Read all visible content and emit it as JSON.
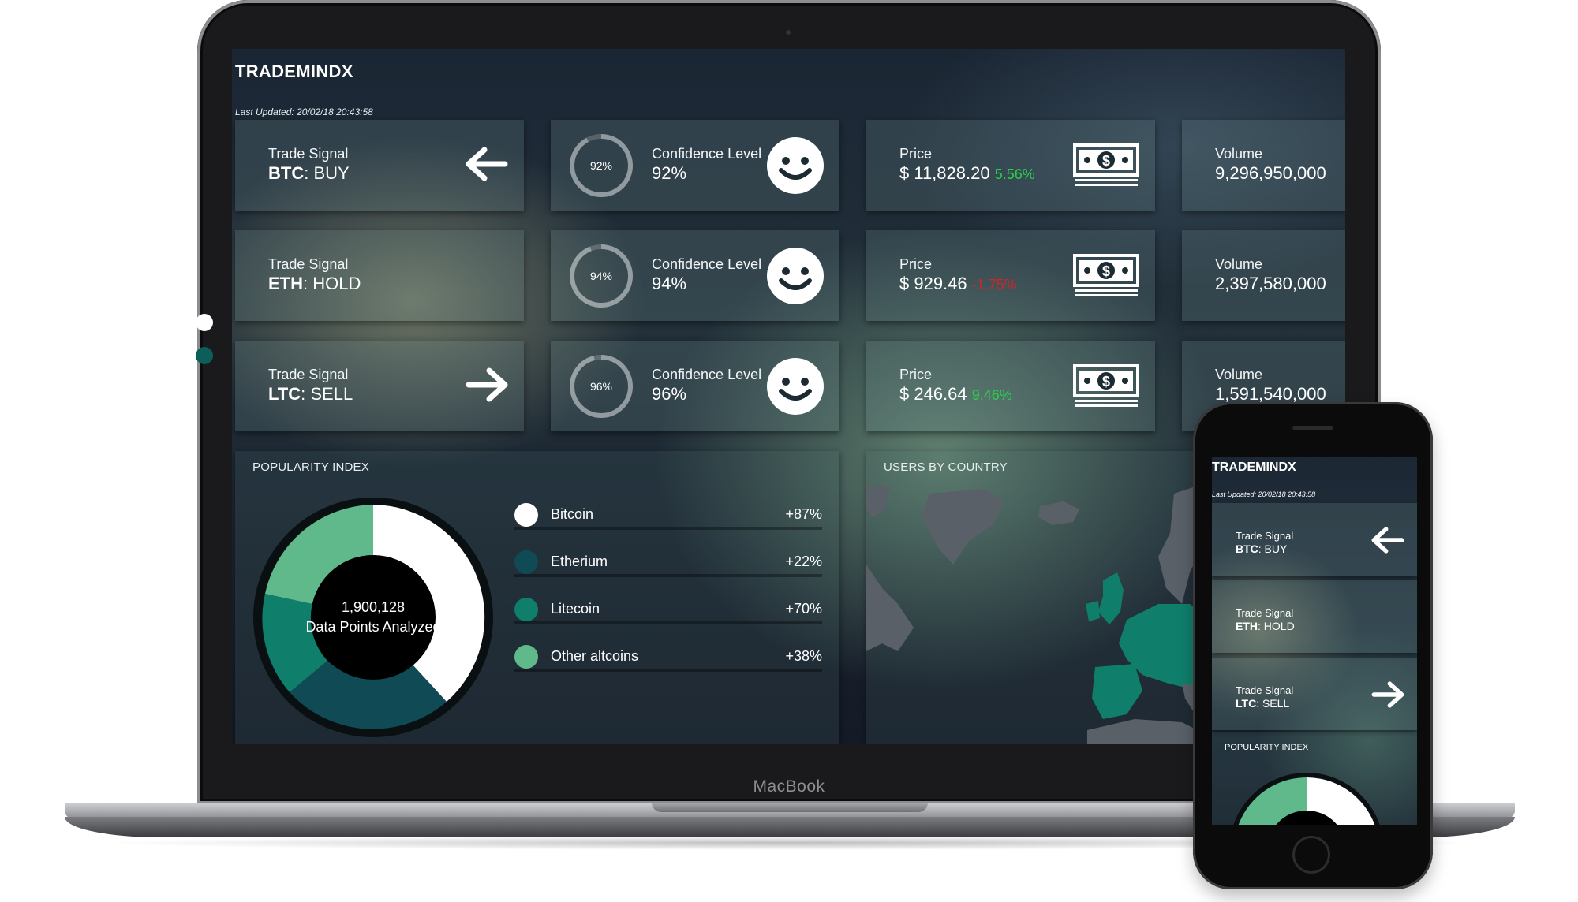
{
  "device": {
    "laptop_label": "MacBook"
  },
  "app": {
    "brand": "TRADEMINDX",
    "last_updated": "Last Updated: 20/02/18 20:43:58"
  },
  "signals": [
    {
      "label": "Trade Signal",
      "coin": "BTC",
      "action": ": BUY",
      "direction": "left"
    },
    {
      "label": "Trade Signal",
      "coin": "ETH",
      "action": ": HOLD",
      "direction": "none"
    },
    {
      "label": "Trade Signal",
      "coin": "LTC",
      "action": ": SELL",
      "direction": "right"
    }
  ],
  "confidence": [
    {
      "ring": "92%",
      "label": "Confidence Level",
      "value": "92%",
      "level": 0.92,
      "icon": "smiley-icon"
    },
    {
      "ring": "94%",
      "label": "Confidence Level",
      "value": "94%",
      "level": 0.94,
      "icon": "smiley-icon"
    },
    {
      "ring": "96%",
      "label": "Confidence Level",
      "value": "96%",
      "level": 0.96,
      "icon": "smiley-icon"
    }
  ],
  "prices": [
    {
      "label": "Price",
      "value": "$ 11,828.20",
      "change": "5.56%",
      "trend": "up",
      "icon": "cash-icon"
    },
    {
      "label": "Price",
      "value": "$ 929.46",
      "change": "-1.75%",
      "trend": "down",
      "icon": "cash-icon"
    },
    {
      "label": "Price",
      "value": "$ 246.64",
      "change": "9.46%",
      "trend": "up",
      "icon": "cash-icon"
    }
  ],
  "volumes": [
    {
      "label": "Volume",
      "value": "9,296,950,000"
    },
    {
      "label": "Volume",
      "value": "2,397,580,000"
    },
    {
      "label": "Volume",
      "value": "1,591,540,000"
    }
  ],
  "popularity": {
    "title": "POPULARITY INDEX",
    "center_value": "1,900,128",
    "center_label": "Data Points Analyzed",
    "legend": [
      {
        "name": "Bitcoin",
        "pct": "+87%",
        "color": "#ffffff"
      },
      {
        "name": "Etherium",
        "pct": "+22%",
        "color": "#0f4a55"
      },
      {
        "name": "Litecoin",
        "pct": "+70%",
        "color": "#0f7f6b"
      },
      {
        "name": "Other altcoins",
        "pct": "+38%",
        "color": "#5fb98a"
      }
    ]
  },
  "users_by_country": {
    "title": "USERS BY COUNTRY"
  },
  "phone": {
    "brand": "TRADEMINDX",
    "last_updated": "Last Updated: 20/02/18 20:43:58",
    "panel_title": "POPULARITY INDEX"
  },
  "colors": {
    "up": "#2bd04a",
    "down": "#d2242c",
    "donut_white": "#ffffff",
    "donut_navy": "#0f4a55",
    "donut_teal": "#0f7f6b",
    "donut_green": "#5fb98a"
  }
}
